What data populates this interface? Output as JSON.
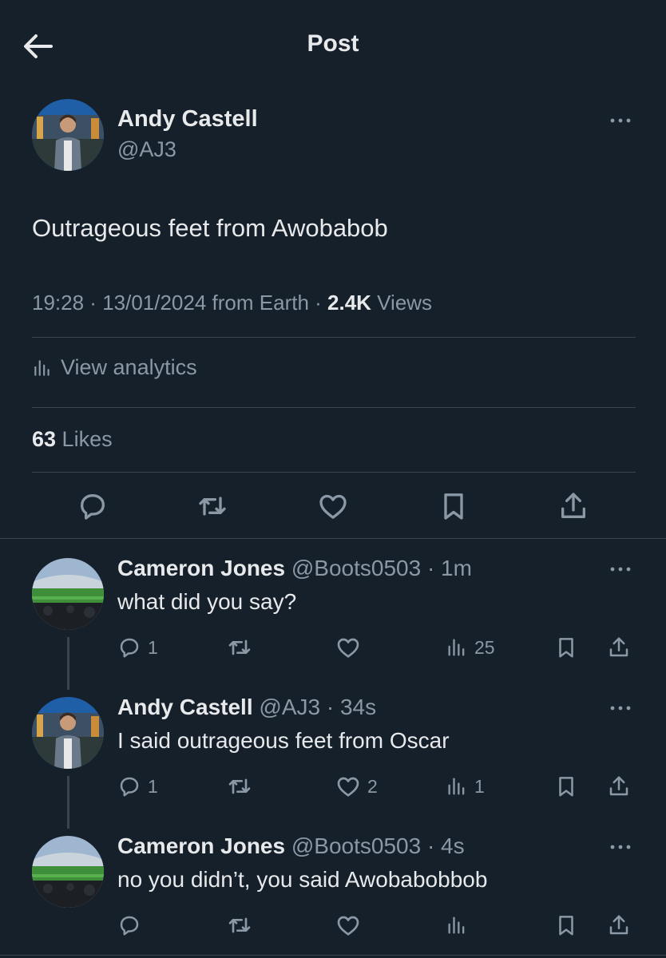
{
  "header": {
    "title": "Post"
  },
  "post": {
    "author_name": "Andy Castell",
    "author_handle": "@AJ3",
    "text": "Outrageous feet from Awobabob",
    "time": "19:28",
    "sep1": " · ",
    "date": "13/01/2024",
    "source": " from Earth",
    "sep2": " · ",
    "views_count": "2.4K",
    "views_label": " Views",
    "analytics_label": "View analytics",
    "likes_count": "63",
    "likes_label": " Likes"
  },
  "replies": [
    {
      "name": "Cameron Jones",
      "handle": " @Boots0503",
      "time": " · 1m",
      "text": "what did you say?",
      "reply_count": "1",
      "retweet_count": "",
      "like_count": "",
      "view_count": "25"
    },
    {
      "name": "Andy Castell",
      "handle": " @AJ3",
      "time": " · 34s",
      "text": "I said outrageous feet from Oscar",
      "reply_count": "1",
      "retweet_count": "",
      "like_count": "2",
      "view_count": "1"
    },
    {
      "name": "Cameron Jones",
      "handle": " @Boots0503",
      "time": " · 4s",
      "text": "no you didn’t, you said Awobabobbob",
      "reply_count": "",
      "retweet_count": "",
      "like_count": "",
      "view_count": ""
    }
  ],
  "colors": {
    "background": "#15202b",
    "text": "#e7e9ea",
    "secondary": "#8b98a5",
    "divider": "#38444d"
  },
  "icons": [
    "back-arrow-icon",
    "more-icon",
    "reply-icon",
    "retweet-icon",
    "like-icon",
    "bookmark-icon",
    "share-icon",
    "analytics-icon"
  ]
}
